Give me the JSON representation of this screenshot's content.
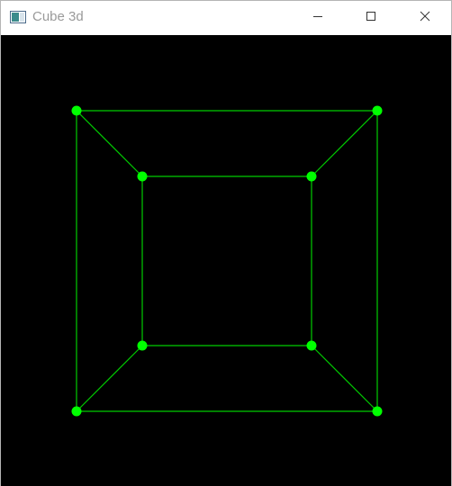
{
  "window": {
    "title": "Cube 3d"
  },
  "title_bar_controls": [
    {
      "name": "minimize-button",
      "icon": "minimize-icon"
    },
    {
      "name": "maximize-button",
      "icon": "maximize-icon"
    },
    {
      "name": "close-button",
      "icon": "close-icon"
    }
  ],
  "colors": {
    "background": "#000000",
    "edge": "#00cc00",
    "vertex": "#00ff00",
    "title_text": "#9a9a9a"
  }
}
